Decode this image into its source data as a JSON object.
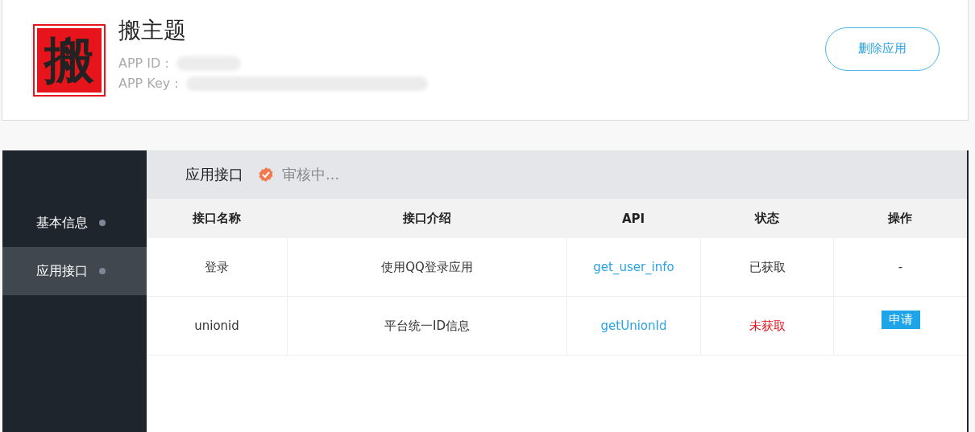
{
  "app": {
    "logo_text": "搬",
    "name": "搬主题",
    "id_label": "APP ID：",
    "key_label": "APP Key：",
    "delete_button": "删除应用"
  },
  "sidebar": {
    "items": [
      {
        "label": "基本信息",
        "selected": false
      },
      {
        "label": "应用接口",
        "selected": true
      }
    ]
  },
  "section": {
    "title": "应用接口",
    "status": "审核中..."
  },
  "table": {
    "columns": [
      "接口名称",
      "接口介绍",
      "API",
      "状态",
      "操作"
    ],
    "rows": [
      {
        "name": "登录",
        "description": "使用QQ登录应用",
        "api": "get_user_info",
        "status": "已获取",
        "obtained": true,
        "action": {
          "kind": "text",
          "label": "-"
        }
      },
      {
        "name": "unionid",
        "description": "平台统一ID信息",
        "api": "getUnionId",
        "status": "未获取",
        "obtained": false,
        "action": {
          "kind": "button",
          "label": "申请"
        }
      }
    ]
  }
}
